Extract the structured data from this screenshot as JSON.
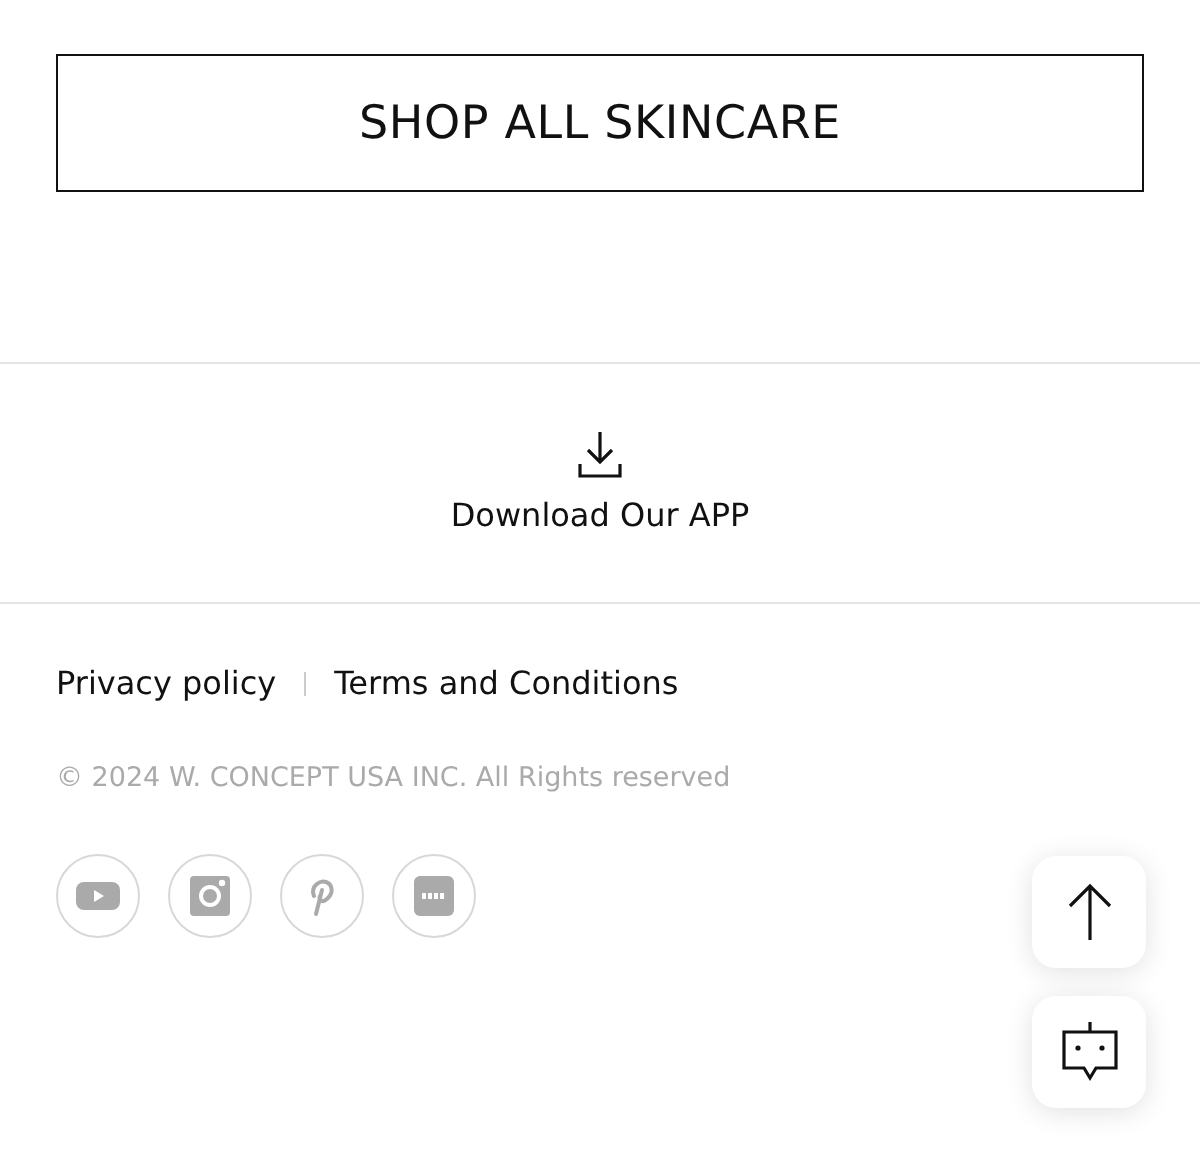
{
  "shop_button": {
    "label": "SHOP ALL SKINCARE"
  },
  "app_download": {
    "label": "Download Our APP"
  },
  "footer_links": [
    "Privacy policy",
    "Terms and Conditions"
  ],
  "copyright": "© 2024 W. CONCEPT USA INC. All Rights reserved",
  "social_links": [
    {
      "kind": "youtube"
    },
    {
      "kind": "instagram"
    },
    {
      "kind": "pinterest"
    },
    {
      "kind": "app"
    }
  ],
  "floating_buttons": [
    {
      "kind": "scroll-top"
    },
    {
      "kind": "chatbot"
    }
  ]
}
